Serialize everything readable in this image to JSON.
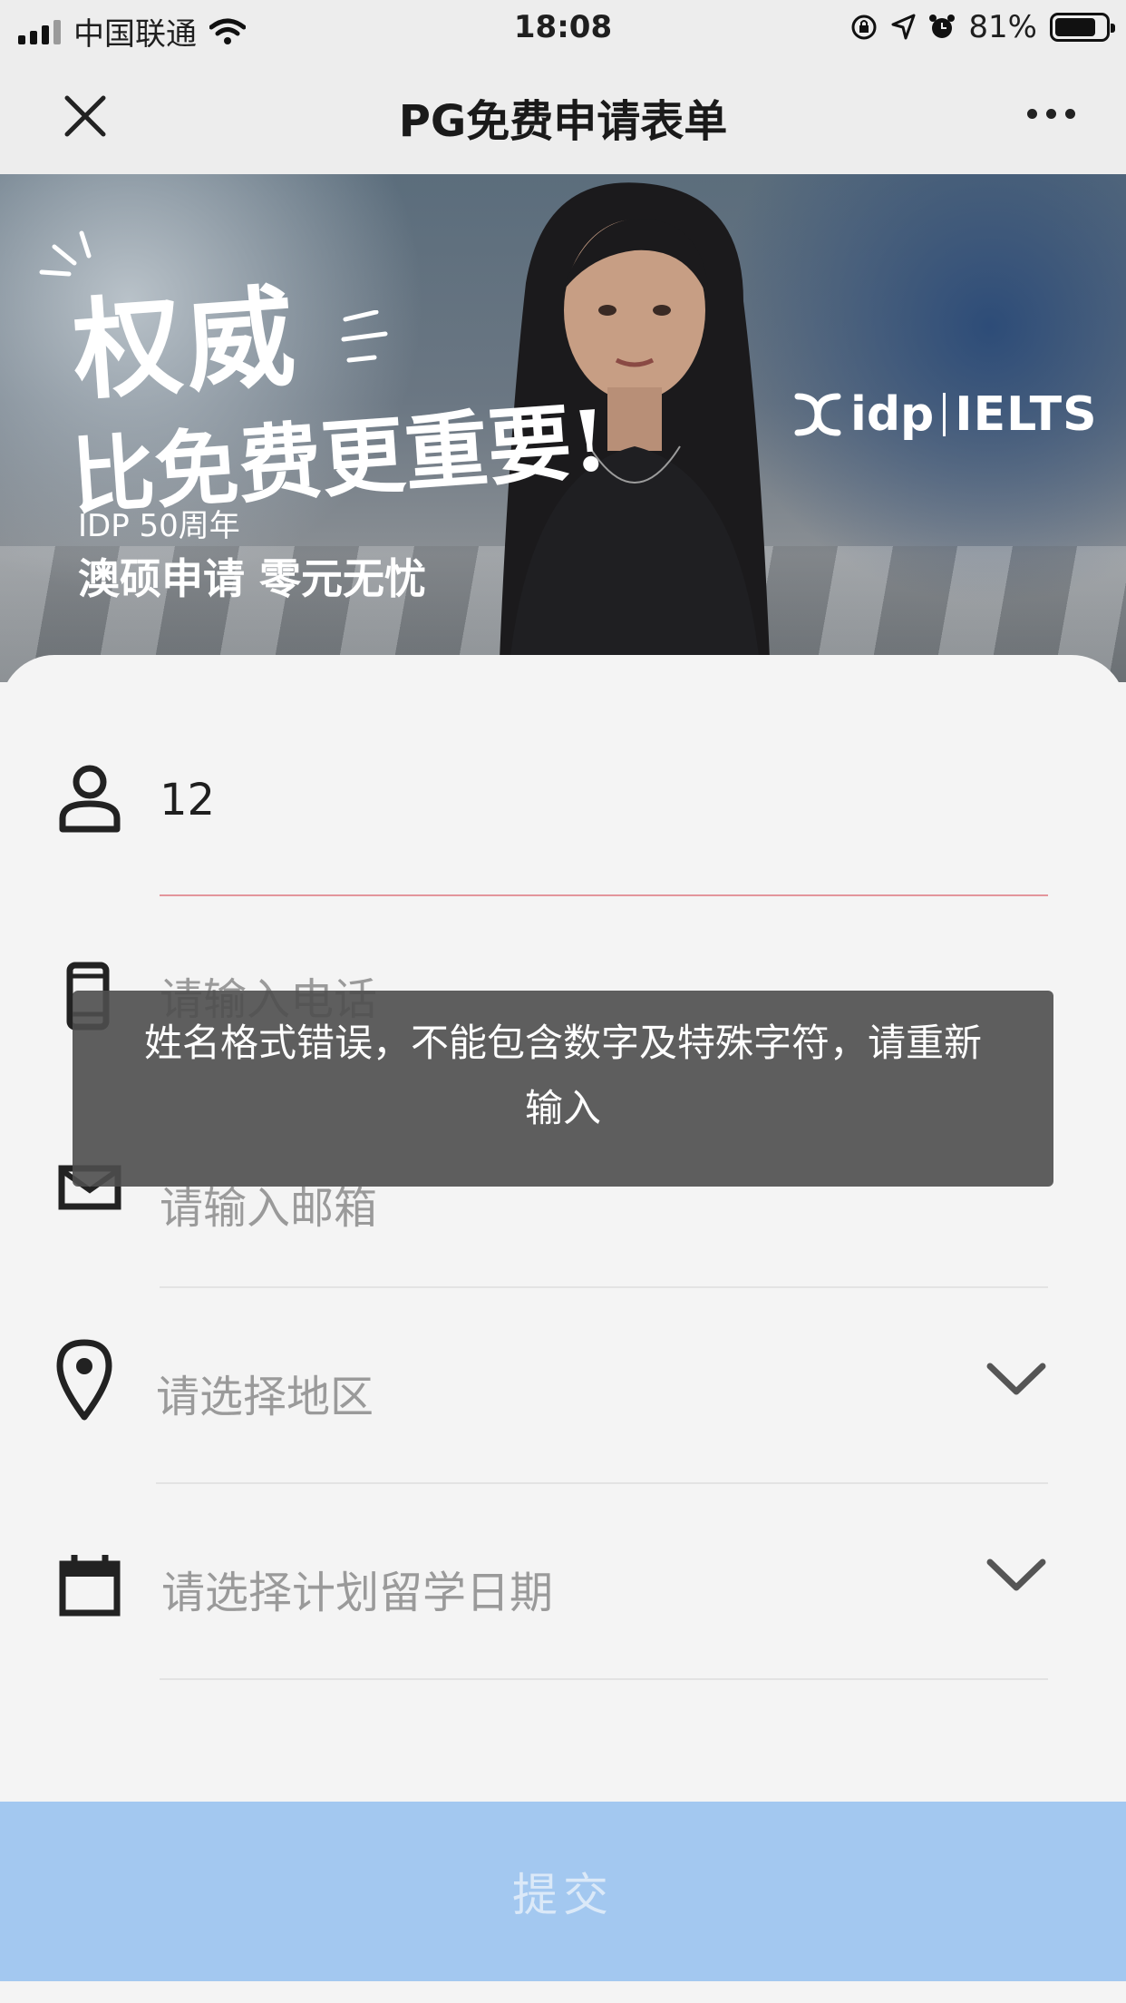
{
  "status_bar": {
    "carrier": "中国联通",
    "time": "18:08",
    "battery_percent": "81%",
    "battery_level": 0.81,
    "icons": [
      "signal-icon",
      "wifi-icon",
      "orientation-lock-icon",
      "location-icon",
      "alarm-icon",
      "battery-icon"
    ]
  },
  "nav": {
    "title": "PG免费申请表单",
    "close_icon": "close-icon",
    "more_icon": "more-icon"
  },
  "banner": {
    "headline_line1": "权威",
    "headline_line2": "比免费更重要!",
    "tagline_small": "IDP 50周年",
    "tagline_large": "澳硕申请 零元无忧",
    "brand_idp": "idp",
    "brand_ielts": "IELTS"
  },
  "form": {
    "name_value": "12",
    "phone_placeholder": "请输入电话",
    "email_placeholder": "请输入邮箱",
    "region_placeholder": "请选择地区",
    "date_placeholder": "请选择计划留学日期",
    "submit_label": "提交"
  },
  "toast": {
    "message": "姓名格式错误，不能包含数字及特殊字符，请重新输入"
  },
  "colors": {
    "nav_background": "#ededed",
    "page_background": "#f4f4f4",
    "error_underline": "#e3959b",
    "toast_background": "#4e4e4e",
    "submit_background": "#a3c8f0"
  }
}
